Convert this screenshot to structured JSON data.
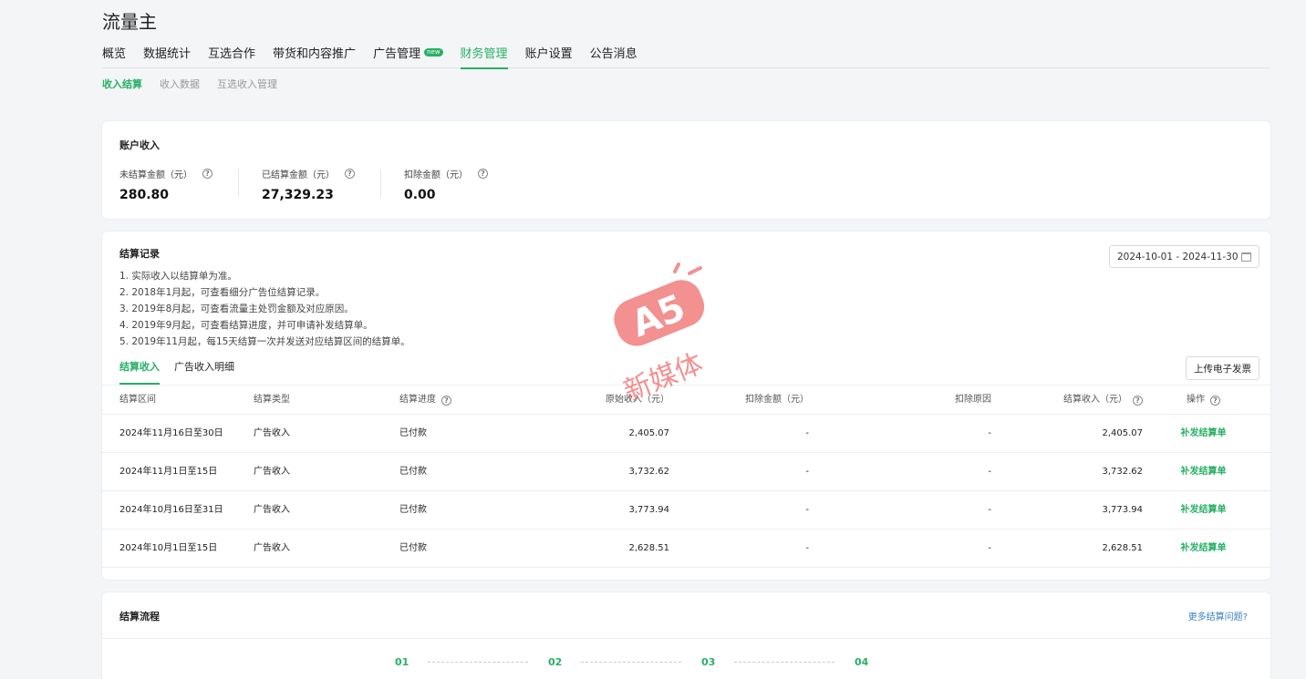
{
  "app": {
    "title": "流量主"
  },
  "nav": {
    "items": [
      {
        "label": "概览"
      },
      {
        "label": "数据统计"
      },
      {
        "label": "互选合作"
      },
      {
        "label": "带货和内容推广"
      },
      {
        "label": "广告管理",
        "badge": "new"
      },
      {
        "label": "财务管理",
        "active": true
      },
      {
        "label": "账户设置"
      },
      {
        "label": "公告消息"
      }
    ]
  },
  "subnav": {
    "items": [
      {
        "label": "收入结算",
        "active": true
      },
      {
        "label": "收入数据"
      },
      {
        "label": "互选收入管理"
      }
    ]
  },
  "account": {
    "title": "账户收入",
    "stats": [
      {
        "label": "未结算金额（元）",
        "value": "280.80"
      },
      {
        "label": "已结算金额（元）",
        "value": "27,329.23"
      },
      {
        "label": "扣除金额（元）",
        "value": "0.00"
      }
    ]
  },
  "records": {
    "title": "结算记录",
    "notes": [
      "1. 实际收入以结算单为准。",
      "2. 2018年1月起，可查看细分广告位结算记录。",
      "3. 2019年8月起，可查看流量主处罚金额及对应原因。",
      "4. 2019年9月起，可查看结算进度，并可申请补发结算单。",
      "5. 2019年11月起，每15天结算一次并发送对应结算区间的结算单。"
    ],
    "date_range": "2024-10-01 - 2024-11-30",
    "upload_label": "上传电子发票",
    "tabs": [
      {
        "label": "结算收入",
        "active": true
      },
      {
        "label": "广告收入明细"
      }
    ],
    "columns": [
      "结算区间",
      "结算类型",
      "结算进度",
      "原始收入（元）",
      "扣除金额（元）",
      "扣除原因",
      "结算收入（元）",
      "操作"
    ],
    "rows": [
      {
        "period": "2024年11月16日至30日",
        "type": "广告收入",
        "progress": "已付款",
        "original": "2,405.07",
        "deduct": "-",
        "reason": "-",
        "income": "2,405.07",
        "action": "补发结算单"
      },
      {
        "period": "2024年11月1日至15日",
        "type": "广告收入",
        "progress": "已付款",
        "original": "3,732.62",
        "deduct": "-",
        "reason": "-",
        "income": "3,732.62",
        "action": "补发结算单"
      },
      {
        "period": "2024年10月16日至31日",
        "type": "广告收入",
        "progress": "已付款",
        "original": "3,773.94",
        "deduct": "-",
        "reason": "-",
        "income": "3,773.94",
        "action": "补发结算单"
      },
      {
        "period": "2024年10月1日至15日",
        "type": "广告收入",
        "progress": "已付款",
        "original": "2,628.51",
        "deduct": "-",
        "reason": "-",
        "income": "2,628.51",
        "action": "补发结算单"
      }
    ]
  },
  "flow": {
    "title": "结算流程",
    "more_link": "更多结算问题?",
    "steps": [
      "01",
      "02",
      "03",
      "04"
    ]
  },
  "watermark": {
    "logo": "A5",
    "text": "新媒体"
  },
  "colors": {
    "accent": "#27b065",
    "link": "#3a82c4",
    "watermark": "#f06c6c"
  }
}
